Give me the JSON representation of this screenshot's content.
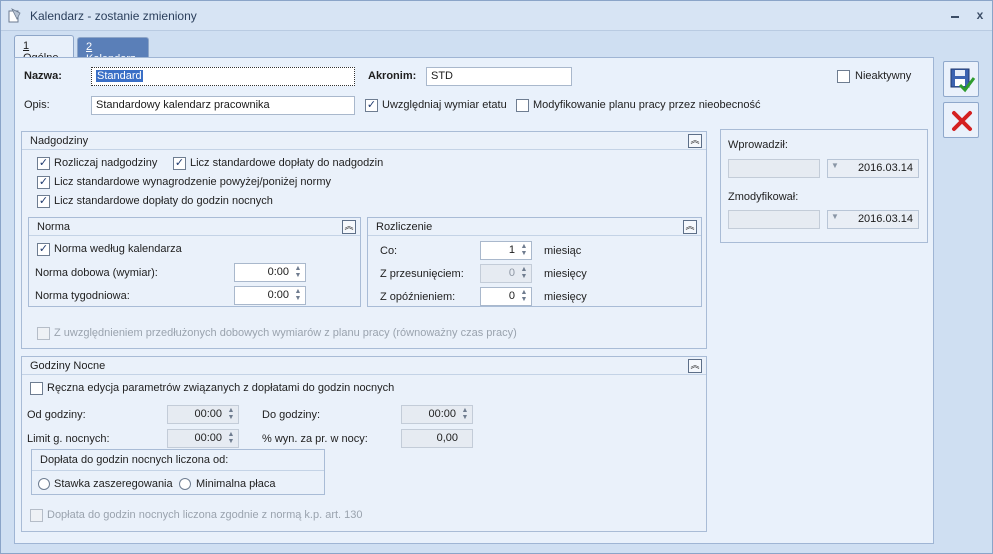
{
  "window": {
    "title": "Kalendarz - zostanie zmieniony",
    "minimize_icon": "minimize-icon",
    "close_label": "x"
  },
  "tabs": [
    {
      "hotkey": "1",
      "label": " Ogólne"
    },
    {
      "hotkey": "2",
      "label": " Kalendarz"
    }
  ],
  "header": {
    "nazwa_label": "Nazwa:",
    "nazwa_value": "Standard",
    "akronim_label": "Akronim:",
    "akronim_value": "STD",
    "nieaktywny_label": "Nieaktywny",
    "opis_label": "Opis:",
    "opis_value": "Standardowy kalendarz pracownika",
    "uwzgledniaj_label": "Uwzględniaj wymiar etatu",
    "modyfikowanie_label": "Modyfikowanie planu pracy przez nieobecność"
  },
  "nadgodziny": {
    "title": "Nadgodziny",
    "rozliczaj": "Rozliczaj nadgodziny",
    "licz_doplaty": "Licz standardowe dopłaty do nadgodzin",
    "licz_wynagrodzenie": "Licz standardowe wynagrodzenie powyżej/poniżej  normy",
    "licz_doplaty_nocne": "Licz standardowe dopłaty do godzin nocnych",
    "z_uwzglednieniem": "Z uwzględnieniem przedłużonych dobowych wymiarów z planu pracy (równoważny czas pracy)"
  },
  "norma": {
    "title": "Norma",
    "wedlug_kalendarza": "Norma według kalendarza",
    "dobowa_label": "Norma dobowa (wymiar):",
    "dobowa_value": "0:00",
    "tygodniowa_label": "Norma tygodniowa:",
    "tygodniowa_value": "0:00"
  },
  "rozliczenie": {
    "title": "Rozliczenie",
    "co_label": "Co:",
    "co_value": "1",
    "co_unit": "miesiąc",
    "przesuniecie_label": "Z przesunięciem:",
    "przesuniecie_value": "0",
    "przesuniecie_unit": "miesięcy",
    "opoznienie_label": "Z opóźnieniem:",
    "opoznienie_value": "0",
    "opoznienie_unit": "miesięcy"
  },
  "audit": {
    "wprowadzil_label": "Wprowadził:",
    "wprowadzil_date": "2016.03.14",
    "zmodyfikowal_label": "Zmodyfikował:",
    "zmodyfikowal_date": "2016.03.14"
  },
  "godziny_nocne": {
    "title": "Godziny Nocne",
    "reczna_edycja": "Ręczna edycja parametrów związanych z dopłatami do godzin nocnych",
    "od_label": "Od godziny:",
    "od_value": "00:00",
    "do_label": "Do godziny:",
    "do_value": "00:00",
    "limit_label": "Limit g. nocnych:",
    "limit_value": "00:00",
    "procent_label": "% wyn. za pr. w nocy:",
    "procent_value": "0,00",
    "doplata_group_title": "Dopłata do godzin nocnych liczona od:",
    "stawka_label": "Stawka zaszeregowania",
    "minimalna_label": "Minimalna płaca",
    "zgodnie_label": "Dopłata do godzin nocnych liczona zgodnie z normą k.p. art. 130"
  },
  "actions": {
    "save_icon": "save-icon",
    "cancel_icon": "cancel-icon"
  },
  "colors": {
    "accent": "#3a6fc6",
    "tab_inactive": "#5a7fb8",
    "cancel_red": "#d42020",
    "check_green": "#2e9c2e"
  }
}
